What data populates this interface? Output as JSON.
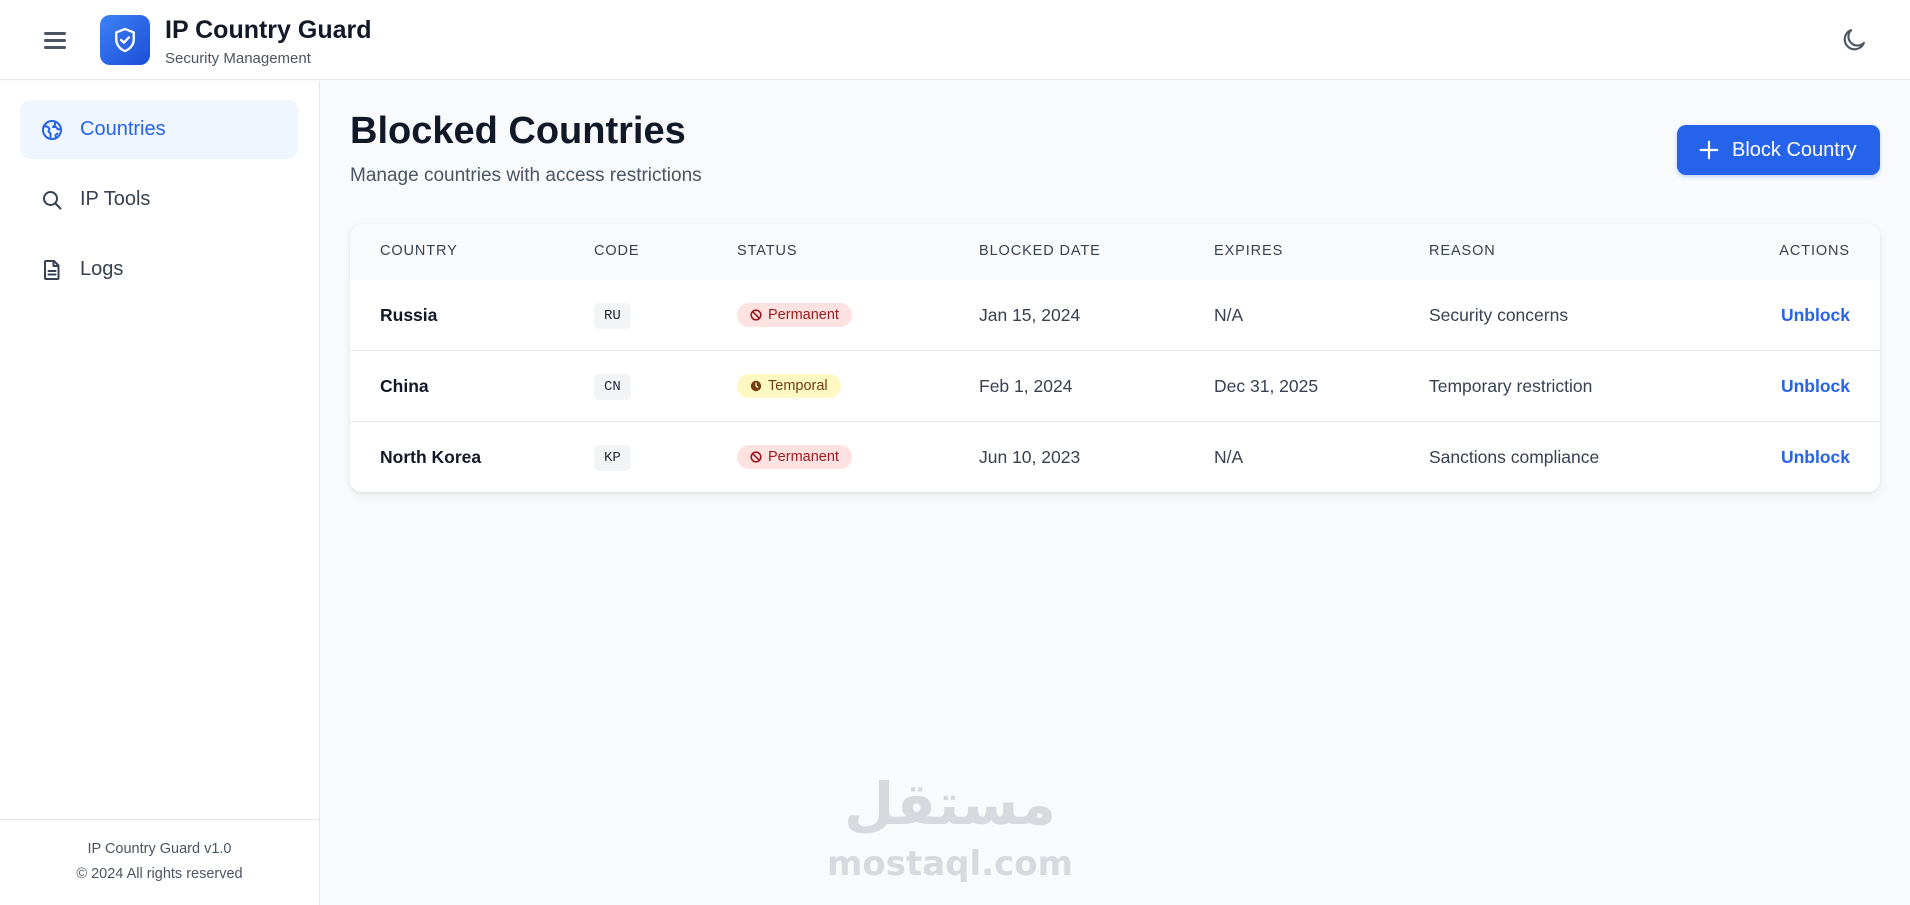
{
  "header": {
    "title": "IP Country Guard",
    "subtitle": "Security Management",
    "menu_icon": "hamburger-icon",
    "logo_icon": "shield-check-icon",
    "theme_icon": "moon-icon"
  },
  "sidebar": {
    "items": [
      {
        "label": "Countries",
        "icon": "globe-icon",
        "active": true
      },
      {
        "label": "IP Tools",
        "icon": "search-icon",
        "active": false
      },
      {
        "label": "Logs",
        "icon": "document-icon",
        "active": false
      }
    ],
    "footer": {
      "version": "IP Country Guard v1.0",
      "copyright": "© 2024 All rights reserved"
    }
  },
  "main": {
    "title": "Blocked Countries",
    "subtitle": "Manage countries with access restrictions",
    "primary_button": "Block Country",
    "columns": [
      "COUNTRY",
      "CODE",
      "STATUS",
      "BLOCKED DATE",
      "EXPIRES",
      "REASON",
      "ACTIONS"
    ],
    "rows": [
      {
        "country": "Russia",
        "code": "RU",
        "status": "Permanent",
        "blocked": "Jan 15, 2024",
        "expires": "N/A",
        "reason": "Security concerns",
        "action": "Unblock"
      },
      {
        "country": "China",
        "code": "CN",
        "status": "Temporal",
        "blocked": "Feb 1, 2024",
        "expires": "Dec 31, 2025",
        "reason": "Temporary restriction",
        "action": "Unblock"
      },
      {
        "country": "North Korea",
        "code": "KP",
        "status": "Permanent",
        "blocked": "Jun 10, 2023",
        "expires": "N/A",
        "reason": "Sanctions compliance",
        "action": "Unblock"
      }
    ]
  },
  "watermark": {
    "arabic": "مستقل",
    "latin": "mostaql.com"
  },
  "colors": {
    "accent": "#2563eb",
    "permanent_bg": "#fee2e2",
    "permanent_text": "#991b1b",
    "temporal_bg": "#fef9c3",
    "temporal_text": "#713f12"
  }
}
